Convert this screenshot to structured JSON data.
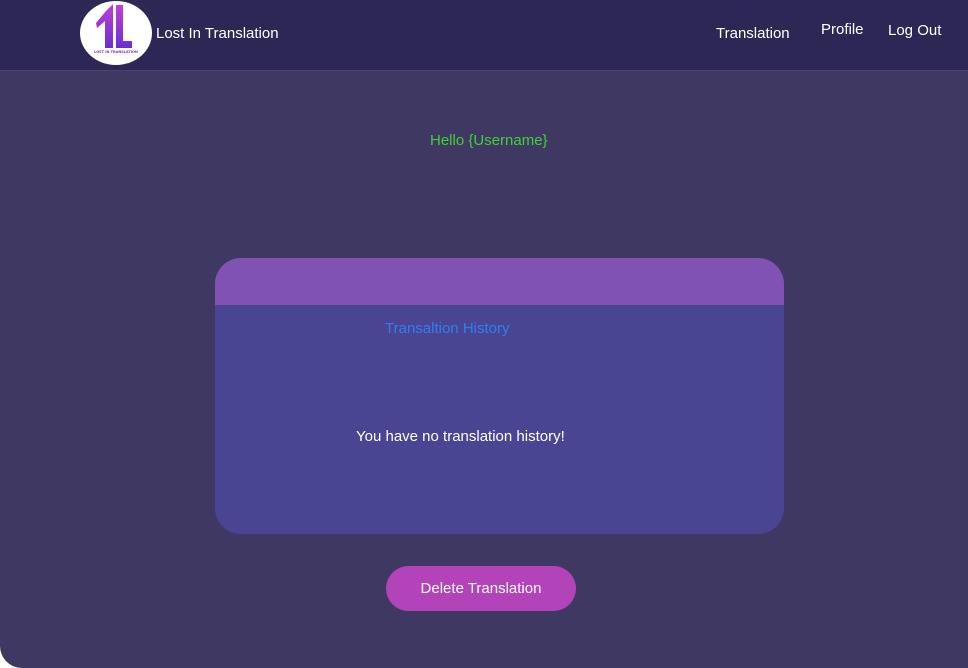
{
  "header": {
    "logo": {
      "icon": "lost-in-translation-logo",
      "caption": "LOST IN TRANSLATION"
    },
    "app_name": "Lost In Translation",
    "nav": {
      "translation": "Translation",
      "profile": "Profile",
      "logout": "Log Out"
    }
  },
  "main": {
    "greeting": "Hello {Username}",
    "history": {
      "title": "Transaltion History",
      "empty_message": "You have no translation history!"
    },
    "delete_button": "Delete Translation"
  },
  "colors": {
    "page_background": "#3f3862",
    "navbar": "#2c2755",
    "card_body": "#4a4593",
    "card_header": "#7f52b4",
    "greeting_text": "#3fd13a",
    "history_title_text": "#2f7ef0",
    "delete_button": "#b243b8"
  }
}
